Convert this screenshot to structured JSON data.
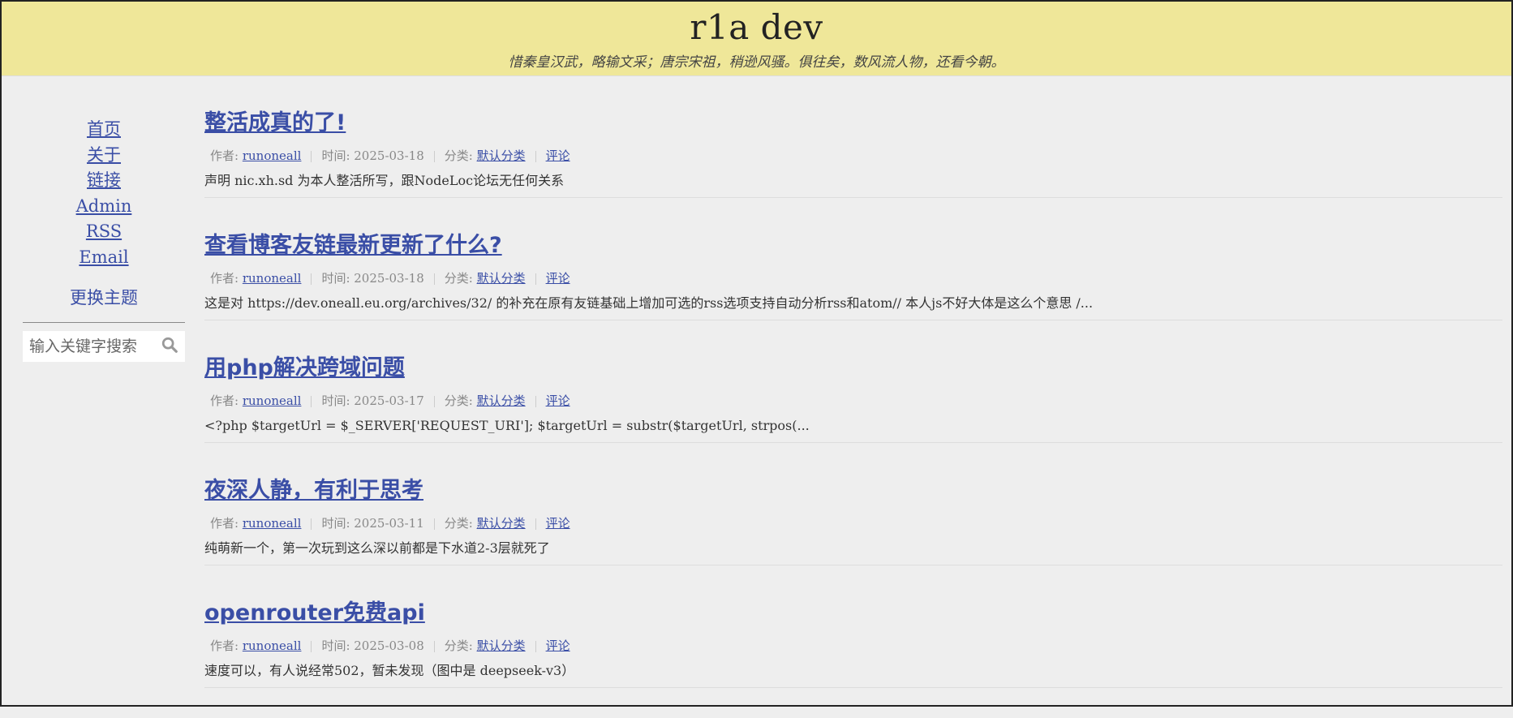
{
  "header": {
    "title": "r1a dev",
    "subtitle": "惜秦皇汉武，略输文采；唐宗宋祖，稍逊风骚。俱往矣，数风流人物，还看今朝。"
  },
  "sidebar": {
    "nav": [
      "首页",
      "关于",
      "链接",
      "Admin",
      "RSS",
      "Email"
    ],
    "theme_label": "更换主题",
    "search_placeholder": "输入关键字搜索"
  },
  "meta_labels": {
    "author": "作者: ",
    "time": "时间: ",
    "category": "分类: "
  },
  "posts": [
    {
      "title": "整活成真的了!",
      "author": "runoneall",
      "date": "2025-03-18",
      "category": "默认分类",
      "comments": "评论",
      "excerpt": "声明 nic.xh.sd 为本人整活所写，跟NodeLoc论坛无任何关系"
    },
    {
      "title": "查看博客友链最新更新了什么?",
      "author": "runoneall",
      "date": "2025-03-18",
      "category": "默认分类",
      "comments": "评论",
      "excerpt": "这是对 https://dev.oneall.eu.org/archives/32/ 的补充在原有友链基础上增加可选的rss选项支持自动分析rss和atom// 本人js不好大体是这么个意思 /..."
    },
    {
      "title": "用php解决跨域问题",
      "author": "runoneall",
      "date": "2025-03-17",
      "category": "默认分类",
      "comments": "评论",
      "excerpt": "<?php $targetUrl = $_SERVER['REQUEST_URI']; $targetUrl = substr($targetUrl, strpos(..."
    },
    {
      "title": "夜深人静，有利于思考",
      "author": "runoneall",
      "date": "2025-03-11",
      "category": "默认分类",
      "comments": "评论",
      "excerpt": "纯萌新一个，第一次玩到这么深以前都是下水道2-3层就死了"
    },
    {
      "title": "openrouter免费api",
      "author": "runoneall",
      "date": "2025-03-08",
      "category": "默认分类",
      "comments": "评论",
      "excerpt": "速度可以，有人说经常502，暂未发现（图中是 deepseek-v3）"
    }
  ],
  "colors": {
    "header_bg": "#efe799",
    "link": "#3a4ea6",
    "page_bg": "#eeeeee"
  }
}
